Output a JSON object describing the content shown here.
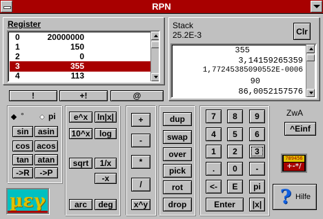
{
  "window": {
    "title": "RPN"
  },
  "register": {
    "heading": "Register",
    "rows": [
      {
        "idx": "0",
        "value": "20000000"
      },
      {
        "idx": "1",
        "value": "150"
      },
      {
        "idx": "2",
        "value": "0"
      },
      {
        "idx": "3",
        "value": "355"
      },
      {
        "idx": "4",
        "value": "113"
      }
    ],
    "selected_index": 3,
    "buttons": [
      "!",
      "+!",
      "@"
    ]
  },
  "stack": {
    "heading": "Stack",
    "display": "25.2E-3",
    "clear_label": "Clr",
    "items": [
      "355",
      "3,14159265359",
      "1,77245385090552E-0006",
      "90",
      "86,0052157576"
    ]
  },
  "angle_mode": {
    "degree_label": "°",
    "pi_label": "pi",
    "selected": "degree"
  },
  "functions": {
    "sin": "sin",
    "asin": "asin",
    "cos": "cos",
    "acos": "acos",
    "tan": "tan",
    "atan": "atan",
    "to_rect": "->R",
    "to_polar": "->P",
    "exp": "e^x",
    "ln": "ln|x|",
    "pow10": "10^x",
    "log": "log",
    "sqrt": "sqrt",
    "reciprocal": "1/x",
    "negate": "-x",
    "arc": "arc",
    "deg": "deg"
  },
  "operators": {
    "add": "+",
    "subtract": "-",
    "multiply": "*",
    "divide": "/",
    "power": "x^y"
  },
  "stack_ops": {
    "dup": "dup",
    "swap": "swap",
    "over": "over",
    "pick": "pick",
    "rot": "rot",
    "drop": "drop"
  },
  "keypad": {
    "seven": "7",
    "eight": "8",
    "nine": "9",
    "four": "4",
    "five": "5",
    "six": "6",
    "one": "1",
    "two": "2",
    "three": "3",
    "point": ".",
    "zero": "0",
    "minus": "-",
    "backspace": "<-",
    "exponent": "E",
    "pi": "pi",
    "enter": "Enter",
    "abs": "|x|"
  },
  "zwa": {
    "label": "ZwA",
    "insert_label": "^Einf"
  },
  "sign_widget": {
    "top_text": "789456",
    "bottom_text": "+-*/"
  },
  "help": {
    "label": "Hilfe",
    "icon_text": "?"
  },
  "logo": {
    "text": "µεγ"
  },
  "colors": {
    "accent": "#a80000",
    "face": "#c0c0c0",
    "logo_bg": "#00c0c0",
    "logo_text": "#e0c000"
  }
}
